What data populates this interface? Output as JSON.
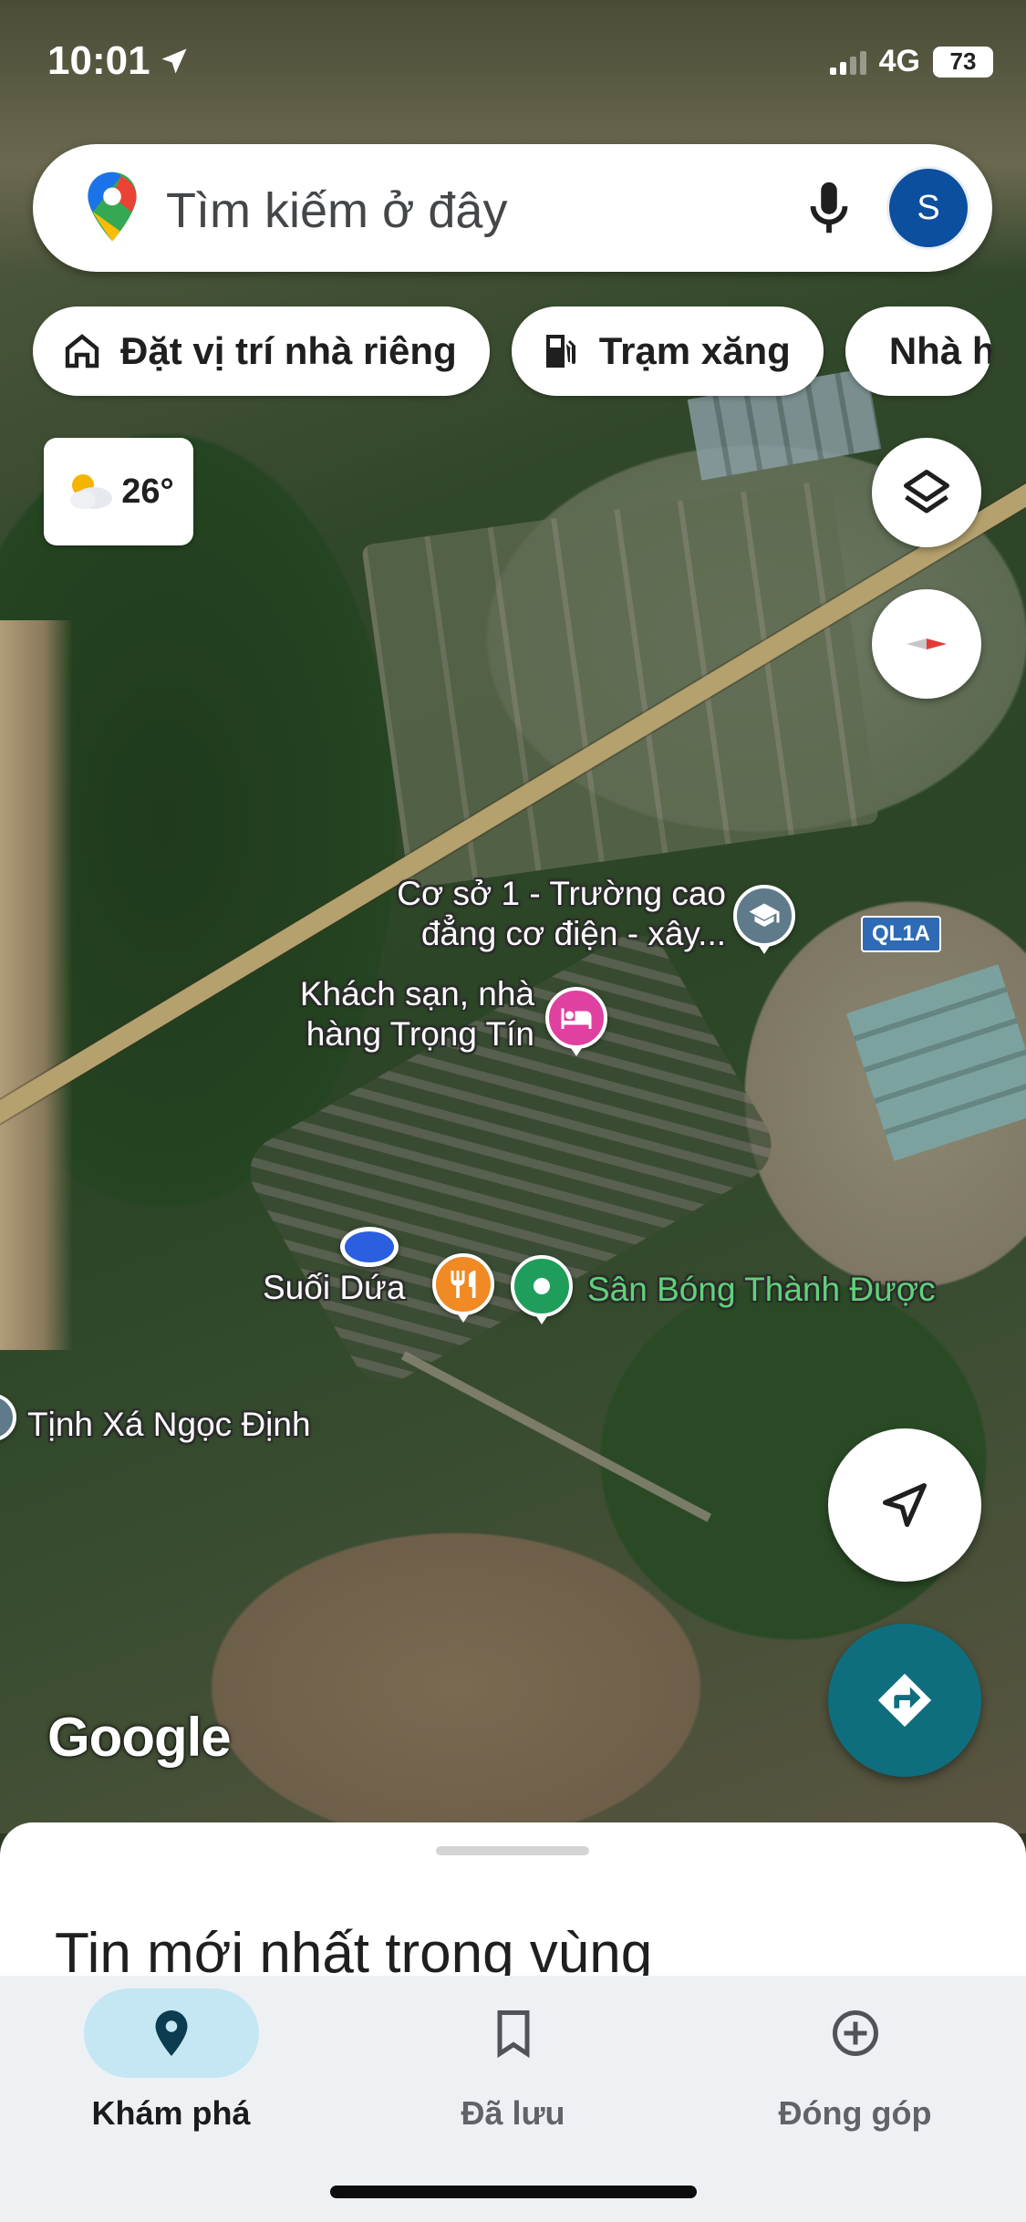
{
  "status_bar": {
    "time": "10:01",
    "network": "4G",
    "battery": "73"
  },
  "search": {
    "placeholder": "Tìm kiếm ở đây",
    "avatar_letter": "S"
  },
  "chips": [
    {
      "label": "Đặt vị trí nhà riêng",
      "icon": "home-icon"
    },
    {
      "label": "Trạm xăng",
      "icon": "gas-station-icon"
    },
    {
      "label": "Nhà hàng",
      "icon": "restaurant-icon"
    }
  ],
  "weather": {
    "temperature": "26°",
    "icon": "partly-cloudy-icon"
  },
  "map_labels": {
    "school": "Cơ sở 1 - Trường cao đẳng cơ điện - xây...",
    "hotel": "Khách sạn, nhà hàng Trọng Tín",
    "suoi_dua": "Suối Dứa",
    "stadium": "Sân Bóng Thành Được",
    "temple": "Tịnh Xá Ngọc Định",
    "road_shield": "QL1A",
    "google": "Google"
  },
  "colors": {
    "directions_button": "#0f6e7e",
    "hotel_pin": "#e040a0",
    "restaurant_pin": "#f08a24",
    "stadium_pin": "#1e9e5a",
    "school_pin": "#5f7a8a",
    "avatar": "#0b4f9e",
    "user_location": "#2b5fe0"
  },
  "sheet": {
    "title": "Tin mới nhất trong vùng"
  },
  "nav": [
    {
      "label": "Khám phá",
      "icon": "location-pin-icon",
      "active": true
    },
    {
      "label": "Đã lưu",
      "icon": "bookmark-icon",
      "active": false
    },
    {
      "label": "Đóng góp",
      "icon": "add-circle-icon",
      "active": false
    }
  ]
}
